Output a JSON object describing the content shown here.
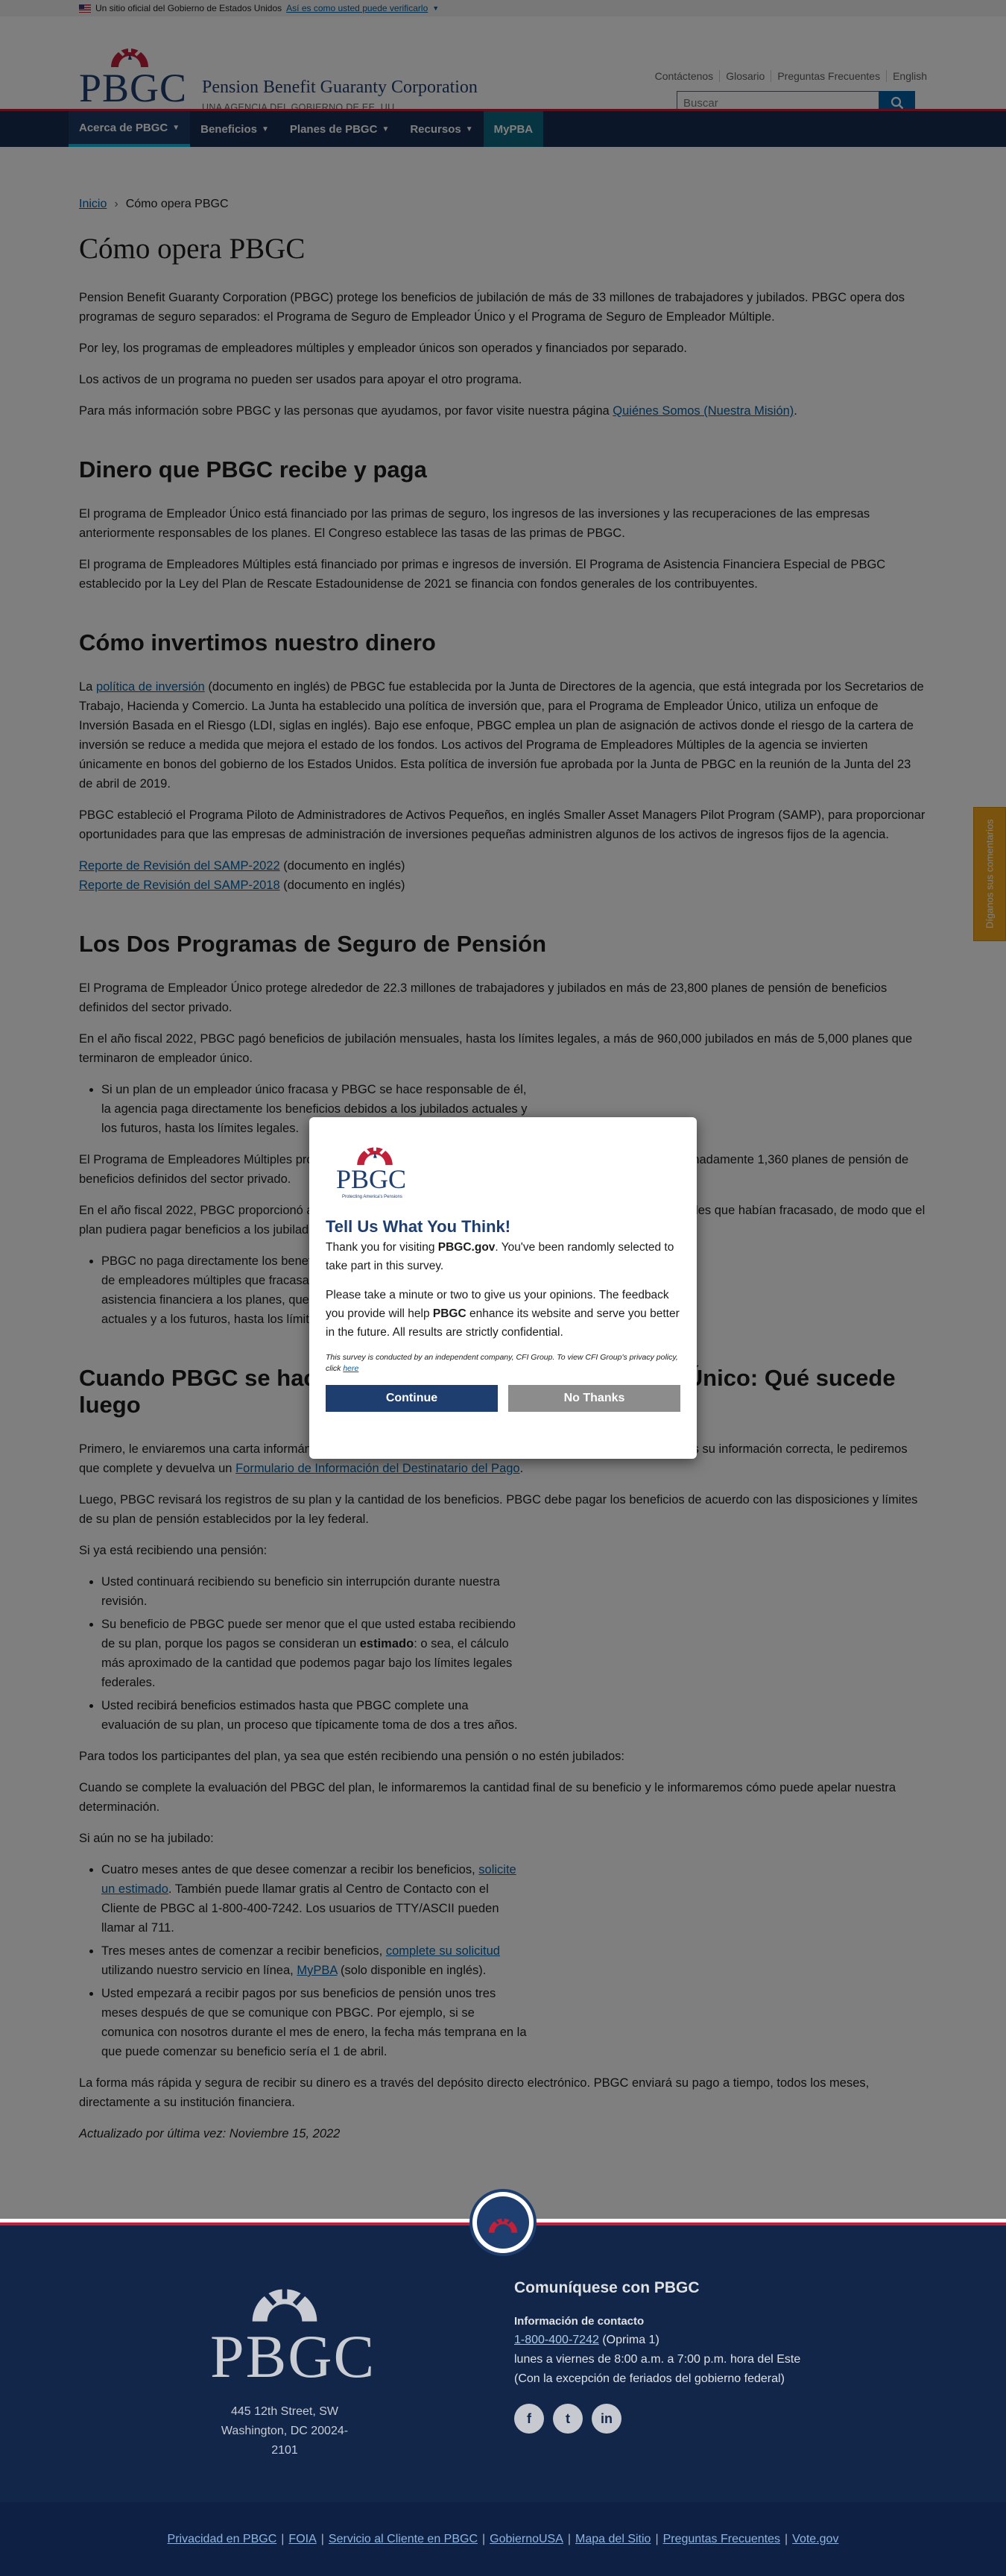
{
  "gov_banner": {
    "text": "Un sitio oficial del Gobierno de Estados Unidos",
    "link": "Así es como usted puede verificarlo"
  },
  "header": {
    "logo_word": "PBGC",
    "title": "Pension Benefit Guaranty Corporation",
    "subtitle": "UNA AGENCIA DEL GOBIERNO DE EE. UU.",
    "utility": [
      "Contáctenos",
      "Glosario",
      "Preguntas Frecuentes",
      "English"
    ],
    "search_placeholder": "Buscar"
  },
  "nav": [
    {
      "label": "Acerca de PBGC"
    },
    {
      "label": "Beneficios"
    },
    {
      "label": "Planes de PBGC"
    },
    {
      "label": "Recursos"
    },
    {
      "label": "MyPBA"
    }
  ],
  "breadcrumb": {
    "home": "Inicio",
    "current": "Cómo opera PBGC"
  },
  "page": {
    "title": "Cómo opera PBGC",
    "intro": [
      "Pension Benefit Guaranty Corporation (PBGC) protege los beneficios de jubilación de más de 33 millones de trabajadores y jubilados. PBGC opera dos programas de seguro separados: el Programa de Seguro de Empleador Único y el Programa de Seguro de Empleador Múltiple.",
      "Por ley, los programas de empleadores múltiples y empleador únicos son operados y financiados por separado.",
      "Los activos de un programa no pueden ser usados para apoyar el otro programa."
    ],
    "intro_more": "Para más información sobre PBGC y las personas que ayudamos, por favor visite nuestra página ",
    "intro_link": "Quiénes Somos (Nuestra Misión)",
    "s1_title": "Dinero que PBGC recibe y paga",
    "s1_p1": "El programa de Empleador Único está financiado por las primas de seguro, los ingresos de las inversiones y las recuperaciones de las empresas anteriormente responsables de los planes. El Congreso establece las tasas de las primas de PBGC.",
    "s1_p2": "El programa de Empleadores Múltiples está financiado por primas e ingresos de inversión. El Programa de Asistencia Financiera Especial de PBGC establecido por la Ley del Plan de Rescate Estadounidense de 2021 se financia con fondos generales de los contribuyentes.",
    "s2_title": "Cómo invertimos nuestro dinero",
    "s2_p1a": "La ",
    "s2_p1_link": "política de inversión",
    "s2_p1b": " (documento en inglés) de PBGC fue establecida por la Junta de Directores de la agencia, que está integrada por los Secretarios de Trabajo, Hacienda y Comercio. La Junta ha establecido una política de inversión que, para el Programa de Empleador Único, utiliza un enfoque de Inversión Basada en el Riesgo (LDI, siglas en inglés). Bajo ese enfoque, PBGC emplea un plan de asignación de activos donde el riesgo de la cartera de inversión se reduce a medida que mejora el estado de los fondos. Los activos del Programa de Empleadores Múltiples de la agencia se invierten únicamente en bonos del gobierno de los Estados Unidos. Esta política de inversión fue aprobada por la Junta de PBGC en la reunión de la Junta del 23 de abril de 2019.",
    "s2_p2": "PBGC estableció el Programa Piloto de Administradores de Activos Pequeños, en inglés Smaller Asset Managers Pilot Program (SAMP), para proporcionar oportunidades para que las empresas de administración de inversiones pequeñas administren algunos de los activos de ingresos fijos de la agencia.",
    "s2_r1": "Reporte de Revisión del SAMP-2022",
    "s2_r2": "Reporte de Revisión del SAMP-2018",
    "s2_doc": " (documento en inglés)",
    "s3_title": "Los Dos Programas de Seguro de Pensión",
    "s3_p1": "El Programa de Empleador Único protege alrededor de 22.3 millones de trabajadores y jubilados en más de 23,800 planes de pensión de beneficios definidos del sector privado.",
    "s3_p2": "En el año fiscal 2022, PBGC pagó  beneficios de jubilación mensuales, hasta los límites legales, a más de 960,000 jubilados en más de 5,000 planes que terminaron de empleador único.",
    "s3_li1": "Si un plan de un empleador único fracasa y PBGC se hace responsable de él, la agencia paga directamente los beneficios debidos a los jubilados actuales y los futuros, hasta los límites legales.",
    "s3_p3": "El Programa de Empleadores Múltiples protege a alrededor de 11 millones de trabajadores y jubilados en aproximadamente 1,360 planes de pensión de beneficios definidos del sector privado.",
    "s3_p4": "En el año fiscal 2022, PBGC proporcionó asistencia financiera a 115 planes de pensiones de empleadores múltiples que habían fracasado, de modo que el plan pudiera pagar beneficios a los jubilados.",
    "s3_li2": "PBGC no paga directamente los beneficios a los participantes de los planes de empleadores múltiples que fracasaron. En cambio, la agencia proporciona asistencia financiera a los planes, que continúan pagando a los jubilados actuales y a los futuros, hasta los límites legales.",
    "s4_title": "Cuando PBGC se hace cargo de un plan de Empleador Único: Qué sucede luego",
    "s4_p1a": "Primero, le enviaremos una carta informándole que nos hemos hecho cargo del plan. Para asegurar que tenemos su información correcta, le pediremos que complete y devuelva un ",
    "s4_p1_link": "Formulario de Información del Destinatario del Pago",
    "s4_p1b": ".",
    "s4_p2": "Luego, PBGC revisará los registros de su plan y la cantidad de los beneficios. PBGC debe pagar los beneficios de acuerdo con las disposiciones y límites de su plan de pensión establecidos por la ley federal.",
    "s4_p3": "Si ya está recibiendo una pensión:",
    "s4_li1": "Usted continuará recibiendo su beneficio sin interrupción durante nuestra revisión.",
    "s4_li2a": "Su beneficio de PBGC puede ser menor que el que usted estaba recibiendo de su plan, porque los pagos se consideran un ",
    "s4_li2b": "estimado",
    "s4_li2c": ": o sea, el cálculo más aproximado de la cantidad que podemos pagar bajo los límites legales federales.",
    "s4_li3": "Usted recibirá beneficios estimados hasta que PBGC complete una evaluación de su plan, un proceso que típicamente toma de dos a tres años.",
    "s4_p4": "Para todos los participantes del plan, ya sea que estén recibiendo una pensión o no estén jubilados:",
    "s4_p5": "Cuando se complete la evaluación del PBGC del plan, le informaremos la cantidad final de su beneficio y le informaremos cómo puede apelar nuestra determinación.",
    "s4_p6": "Si aún no se ha jubilado:",
    "s4_li4a": "Cuatro meses antes de que desee comenzar a recibir los beneficios, ",
    "s4_li4_link": "solicite un estimado",
    "s4_li4b": ". También puede llamar gratis al Centro de Contacto con el Cliente de PBGC al 1-800-400-7242. Los usuarios de TTY/ASCII pueden llamar al 711.",
    "s4_li5a": "Tres meses antes de comenzar a recibir beneficios, ",
    "s4_li5_link": "complete su solicitud",
    "s4_li5b": " utilizando nuestro servicio en línea, ",
    "s4_li5_link2": "MyPBA",
    "s4_li5c": " (solo disponible en inglés).",
    "s4_li6": "Usted empezará a recibir pagos por sus beneficios de pensión unos tres meses después de que se comunique con PBGC. Por ejemplo, si se comunica con nosotros durante el mes de enero, la fecha más temprana en la que puede comenzar su beneficio sería el 1 de abril.",
    "s4_p7": "La forma más rápida y segura de recibir su dinero es a través del depósito directo electrónico. PBGC enviará su pago a tiempo, todos los meses, directamente a su institución financiera.",
    "updated": "Actualizado por última vez: Noviembre 15, 2022"
  },
  "feedback_tab": "Díganos sus comentarios",
  "modal": {
    "logo_word": "PBGC",
    "logo_tag": "Protecting America's Pensions",
    "title": "Tell Us What You Think!",
    "p1a": "Thank you for visiting ",
    "p1b": "PBGC.gov",
    "p1c": ". You've been randomly selected to take part in this survey.",
    "p2a": "Please take a minute or two to give us your opinions. The feedback you provide will help ",
    "p2b": "PBGC",
    "p2c": " enhance its website and serve you better in the future. All results are strictly confidential.",
    "fine": "This survey is conducted by an independent company, CFI Group. To view CFI Group's privacy policy, click ",
    "fine_link": "here",
    "continue": "Continue",
    "no_thanks": "No Thanks"
  },
  "footer": {
    "logo_word": "PBGC",
    "address1": "445 12th Street, SW",
    "address2": "Washington, DC 20024-2101",
    "contact_title": "Comuníquese con PBGC",
    "contact_label": "Información de contacto",
    "phone": "1-800-400-7242",
    "phone_opt": " (Oprima 1)",
    "hours": "lunes a viernes de 8:00 a.m. a 7:00 p.m. hora del Este",
    "holidays": "(Con la excepción de feriados del gobierno federal)",
    "social": [
      "f",
      "t",
      "in"
    ]
  },
  "bottom_links": [
    "Privacidad en PBGC",
    "FOIA",
    "Servicio al Cliente en PBGC",
    "GobiernoUSA",
    "Mapa del Sitio",
    "Preguntas Frecuentes",
    "Vote.gov"
  ]
}
